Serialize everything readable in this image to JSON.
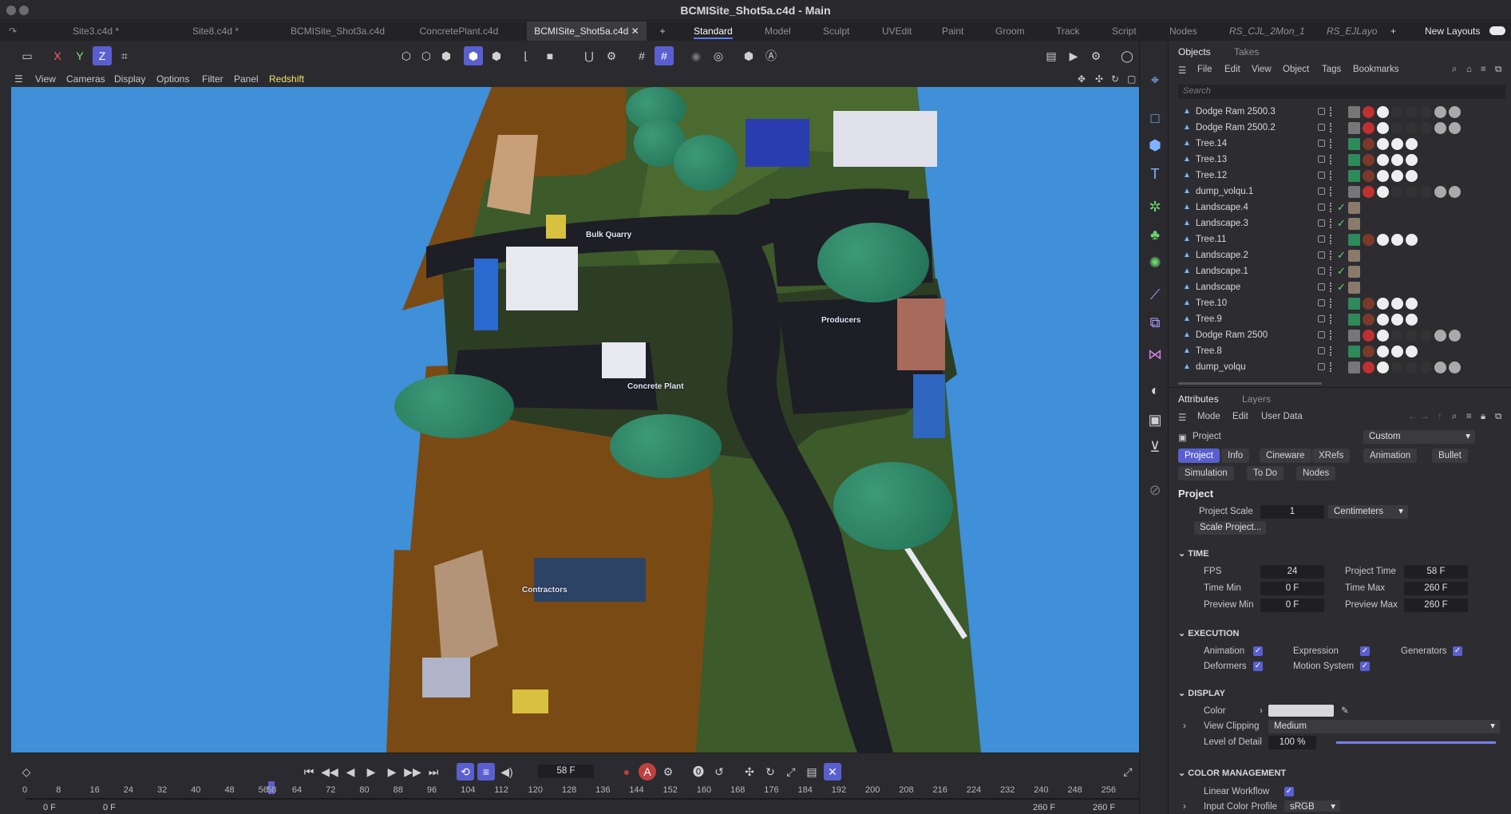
{
  "window": {
    "title": "BCMISite_Shot5a.c4d - Main"
  },
  "doc_tabs": [
    "Site3.c4d *",
    "Site8.c4d *",
    "BCMISite_Shot3a.c4d",
    "ConcretePlant.c4d",
    "BCMISite_Shot5a.c4d"
  ],
  "layouts": [
    "Standard",
    "Model",
    "Sculpt",
    "UVEdit",
    "Paint",
    "Groom",
    "Track",
    "Script",
    "Nodes",
    "RS_CJL_2Mon_1",
    "RS_EJLayo",
    "New Layouts"
  ],
  "axis": {
    "x": "X",
    "y": "Y",
    "z": "Z"
  },
  "viewport_menu": [
    "View",
    "Cameras",
    "Display",
    "Options",
    "Filter",
    "Panel",
    "Redshift"
  ],
  "scene_labels": {
    "quarry": "Bulk Quarry",
    "producers": "Producers",
    "plant": "Concrete Plant",
    "contractors": "Contractors"
  },
  "timeline": {
    "current_frame": "58 F",
    "ticks": [
      "0",
      "8",
      "16",
      "24",
      "32",
      "40",
      "48",
      "56",
      "58",
      "64",
      "72",
      "80",
      "88",
      "96",
      "104",
      "112",
      "120",
      "128",
      "136",
      "144",
      "152",
      "160",
      "168",
      "176",
      "184",
      "192",
      "200",
      "208",
      "216",
      "224",
      "232",
      "240",
      "248",
      "256"
    ],
    "start_a": "0 F",
    "start_b": "0 F",
    "end_a": "260 F",
    "end_b": "260 F"
  },
  "objects_panel": {
    "tabs": [
      "Objects",
      "Takes"
    ],
    "menu": [
      "File",
      "Edit",
      "View",
      "Object",
      "Tags",
      "Bookmarks"
    ],
    "search_placeholder": "Search",
    "items": [
      {
        "name": "Dodge Ram 2500.3",
        "check": false
      },
      {
        "name": "Dodge Ram 2500.2",
        "check": false
      },
      {
        "name": "Tree.14",
        "check": false
      },
      {
        "name": "Tree.13",
        "check": false
      },
      {
        "name": "Tree.12",
        "check": false
      },
      {
        "name": "dump_volqu.1",
        "check": false
      },
      {
        "name": "Landscape.4",
        "check": true
      },
      {
        "name": "Landscape.3",
        "check": true
      },
      {
        "name": "Tree.11",
        "check": false
      },
      {
        "name": "Landscape.2",
        "check": true
      },
      {
        "name": "Landscape.1",
        "check": true
      },
      {
        "name": "Landscape",
        "check": true
      },
      {
        "name": "Tree.10",
        "check": false
      },
      {
        "name": "Tree.9",
        "check": false
      },
      {
        "name": "Dodge Ram 2500",
        "check": false
      },
      {
        "name": "Tree.8",
        "check": false
      },
      {
        "name": "dump_volqu",
        "check": false
      }
    ]
  },
  "attributes_panel": {
    "tabs": [
      "Attributes",
      "Layers"
    ],
    "menu": [
      "Mode",
      "Edit",
      "User Data"
    ],
    "header": "Project",
    "preset": "Custom",
    "buttons_row1": [
      "Project",
      "Info",
      "Cineware",
      "XRefs",
      "Animation",
      "Bullet"
    ],
    "buttons_row2": [
      "Simulation",
      "To Do",
      "Nodes"
    ],
    "section_title": "Project",
    "project_scale_label": "Project Scale",
    "project_scale_value": "1",
    "project_scale_unit": "Centimeters",
    "scale_button": "Scale Project...",
    "time": {
      "title": "TIME",
      "fps_label": "FPS",
      "fps": "24",
      "project_time_label": "Project Time",
      "project_time": "58 F",
      "time_min_label": "Time Min",
      "time_min": "0 F",
      "time_max_label": "Time Max",
      "time_max": "260 F",
      "preview_min_label": "Preview Min",
      "preview_min": "0 F",
      "preview_max_label": "Preview Max",
      "preview_max": "260 F"
    },
    "execution": {
      "title": "EXECUTION",
      "animation": "Animation",
      "expression": "Expression",
      "generators": "Generators",
      "deformers": "Deformers",
      "motion_system": "Motion System"
    },
    "display": {
      "title": "DISPLAY",
      "color_label": "Color",
      "view_clipping_label": "View Clipping",
      "view_clipping": "Medium",
      "lod_label": "Level of Detail",
      "lod": "100 %",
      "lod_level": 1.0
    },
    "color_management": {
      "title": "COLOR MANAGEMENT",
      "linear_workflow": "Linear Workflow",
      "input_profile_label": "Input Color Profile",
      "input_profile": "sRGB"
    }
  },
  "colors": {
    "accent": "#5a5fd0",
    "sky": "#3f8fd9",
    "grass": "#3c5a2a",
    "dirt": "#7a4a14",
    "road": "#1e1e26"
  }
}
